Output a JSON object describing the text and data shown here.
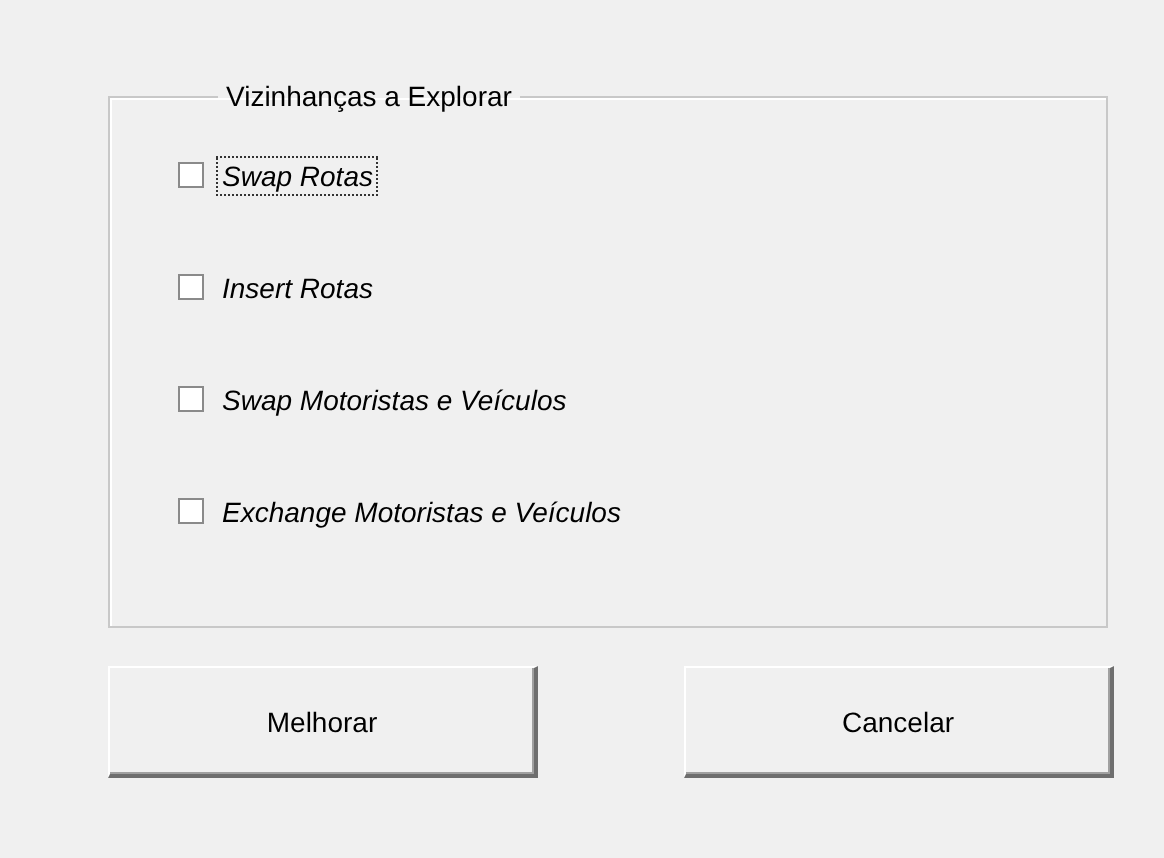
{
  "group": {
    "title": "Vizinhanças a Explorar",
    "options": [
      {
        "label": "Swap Rotas",
        "checked": false,
        "focused": true
      },
      {
        "label": "Insert Rotas",
        "checked": false,
        "focused": false
      },
      {
        "label": "Swap Motoristas e Veículos",
        "checked": false,
        "focused": false
      },
      {
        "label": "Exchange Motoristas e Veículos",
        "checked": false,
        "focused": false
      }
    ]
  },
  "buttons": [
    "Melhorar",
    "Cancelar"
  ]
}
